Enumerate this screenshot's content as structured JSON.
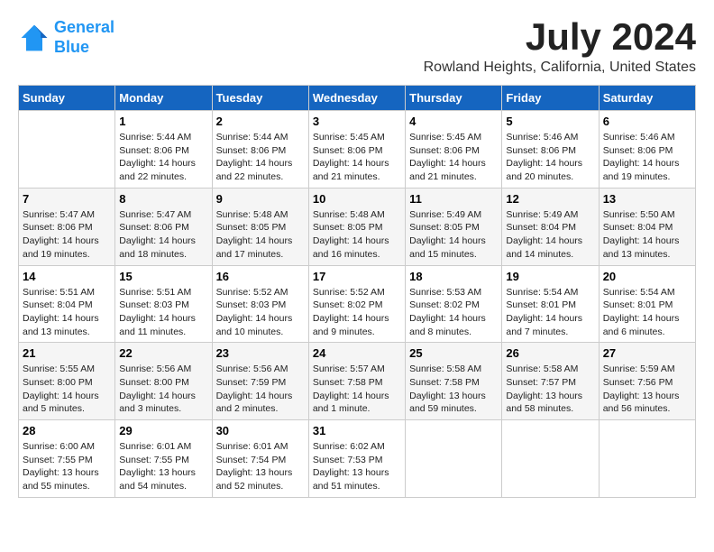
{
  "logo": {
    "line1": "General",
    "line2": "Blue"
  },
  "title": "July 2024",
  "location": "Rowland Heights, California, United States",
  "weekdays": [
    "Sunday",
    "Monday",
    "Tuesday",
    "Wednesday",
    "Thursday",
    "Friday",
    "Saturday"
  ],
  "weeks": [
    [
      {
        "day": "",
        "info": ""
      },
      {
        "day": "1",
        "info": "Sunrise: 5:44 AM\nSunset: 8:06 PM\nDaylight: 14 hours\nand 22 minutes."
      },
      {
        "day": "2",
        "info": "Sunrise: 5:44 AM\nSunset: 8:06 PM\nDaylight: 14 hours\nand 22 minutes."
      },
      {
        "day": "3",
        "info": "Sunrise: 5:45 AM\nSunset: 8:06 PM\nDaylight: 14 hours\nand 21 minutes."
      },
      {
        "day": "4",
        "info": "Sunrise: 5:45 AM\nSunset: 8:06 PM\nDaylight: 14 hours\nand 21 minutes."
      },
      {
        "day": "5",
        "info": "Sunrise: 5:46 AM\nSunset: 8:06 PM\nDaylight: 14 hours\nand 20 minutes."
      },
      {
        "day": "6",
        "info": "Sunrise: 5:46 AM\nSunset: 8:06 PM\nDaylight: 14 hours\nand 19 minutes."
      }
    ],
    [
      {
        "day": "7",
        "info": "Sunrise: 5:47 AM\nSunset: 8:06 PM\nDaylight: 14 hours\nand 19 minutes."
      },
      {
        "day": "8",
        "info": "Sunrise: 5:47 AM\nSunset: 8:06 PM\nDaylight: 14 hours\nand 18 minutes."
      },
      {
        "day": "9",
        "info": "Sunrise: 5:48 AM\nSunset: 8:05 PM\nDaylight: 14 hours\nand 17 minutes."
      },
      {
        "day": "10",
        "info": "Sunrise: 5:48 AM\nSunset: 8:05 PM\nDaylight: 14 hours\nand 16 minutes."
      },
      {
        "day": "11",
        "info": "Sunrise: 5:49 AM\nSunset: 8:05 PM\nDaylight: 14 hours\nand 15 minutes."
      },
      {
        "day": "12",
        "info": "Sunrise: 5:49 AM\nSunset: 8:04 PM\nDaylight: 14 hours\nand 14 minutes."
      },
      {
        "day": "13",
        "info": "Sunrise: 5:50 AM\nSunset: 8:04 PM\nDaylight: 14 hours\nand 13 minutes."
      }
    ],
    [
      {
        "day": "14",
        "info": "Sunrise: 5:51 AM\nSunset: 8:04 PM\nDaylight: 14 hours\nand 13 minutes."
      },
      {
        "day": "15",
        "info": "Sunrise: 5:51 AM\nSunset: 8:03 PM\nDaylight: 14 hours\nand 11 minutes."
      },
      {
        "day": "16",
        "info": "Sunrise: 5:52 AM\nSunset: 8:03 PM\nDaylight: 14 hours\nand 10 minutes."
      },
      {
        "day": "17",
        "info": "Sunrise: 5:52 AM\nSunset: 8:02 PM\nDaylight: 14 hours\nand 9 minutes."
      },
      {
        "day": "18",
        "info": "Sunrise: 5:53 AM\nSunset: 8:02 PM\nDaylight: 14 hours\nand 8 minutes."
      },
      {
        "day": "19",
        "info": "Sunrise: 5:54 AM\nSunset: 8:01 PM\nDaylight: 14 hours\nand 7 minutes."
      },
      {
        "day": "20",
        "info": "Sunrise: 5:54 AM\nSunset: 8:01 PM\nDaylight: 14 hours\nand 6 minutes."
      }
    ],
    [
      {
        "day": "21",
        "info": "Sunrise: 5:55 AM\nSunset: 8:00 PM\nDaylight: 14 hours\nand 5 minutes."
      },
      {
        "day": "22",
        "info": "Sunrise: 5:56 AM\nSunset: 8:00 PM\nDaylight: 14 hours\nand 3 minutes."
      },
      {
        "day": "23",
        "info": "Sunrise: 5:56 AM\nSunset: 7:59 PM\nDaylight: 14 hours\nand 2 minutes."
      },
      {
        "day": "24",
        "info": "Sunrise: 5:57 AM\nSunset: 7:58 PM\nDaylight: 14 hours\nand 1 minute."
      },
      {
        "day": "25",
        "info": "Sunrise: 5:58 AM\nSunset: 7:58 PM\nDaylight: 13 hours\nand 59 minutes."
      },
      {
        "day": "26",
        "info": "Sunrise: 5:58 AM\nSunset: 7:57 PM\nDaylight: 13 hours\nand 58 minutes."
      },
      {
        "day": "27",
        "info": "Sunrise: 5:59 AM\nSunset: 7:56 PM\nDaylight: 13 hours\nand 56 minutes."
      }
    ],
    [
      {
        "day": "28",
        "info": "Sunrise: 6:00 AM\nSunset: 7:55 PM\nDaylight: 13 hours\nand 55 minutes."
      },
      {
        "day": "29",
        "info": "Sunrise: 6:01 AM\nSunset: 7:55 PM\nDaylight: 13 hours\nand 54 minutes."
      },
      {
        "day": "30",
        "info": "Sunrise: 6:01 AM\nSunset: 7:54 PM\nDaylight: 13 hours\nand 52 minutes."
      },
      {
        "day": "31",
        "info": "Sunrise: 6:02 AM\nSunset: 7:53 PM\nDaylight: 13 hours\nand 51 minutes."
      },
      {
        "day": "",
        "info": ""
      },
      {
        "day": "",
        "info": ""
      },
      {
        "day": "",
        "info": ""
      }
    ]
  ]
}
